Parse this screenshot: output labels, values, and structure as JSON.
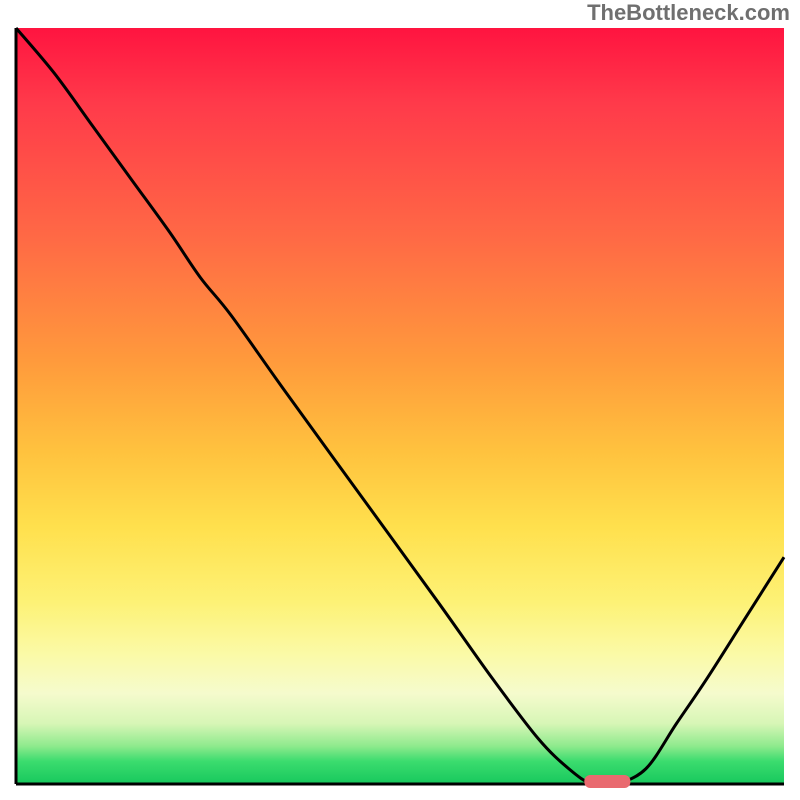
{
  "watermark_text": "TheBottleneck.com",
  "colors": {
    "watermark": "#6f6f6f",
    "axis": "#000000",
    "curve": "#000000",
    "marker": "#e96a6f",
    "gradient_top": "#ff1440",
    "gradient_bottom": "#17c85d"
  },
  "chart_data": {
    "type": "line",
    "title": "",
    "xlabel": "",
    "ylabel": "",
    "xlim": [
      0,
      100
    ],
    "ylim": [
      0,
      100
    ],
    "grid": false,
    "legend": false,
    "series": [
      {
        "name": "bottleneck-curve",
        "x": [
          0,
          5,
          10,
          15,
          20,
          24,
          28,
          35,
          45,
          55,
          62,
          68,
          72,
          75,
          78,
          82,
          86,
          90,
          95,
          100
        ],
        "y": [
          100,
          94,
          87,
          80,
          73,
          67,
          62,
          52,
          38,
          24,
          14,
          6,
          2,
          0,
          0,
          2,
          8,
          14,
          22,
          30
        ]
      }
    ],
    "marker": {
      "name": "optimal-range",
      "x_start": 74,
      "x_end": 80,
      "y": 0
    }
  }
}
